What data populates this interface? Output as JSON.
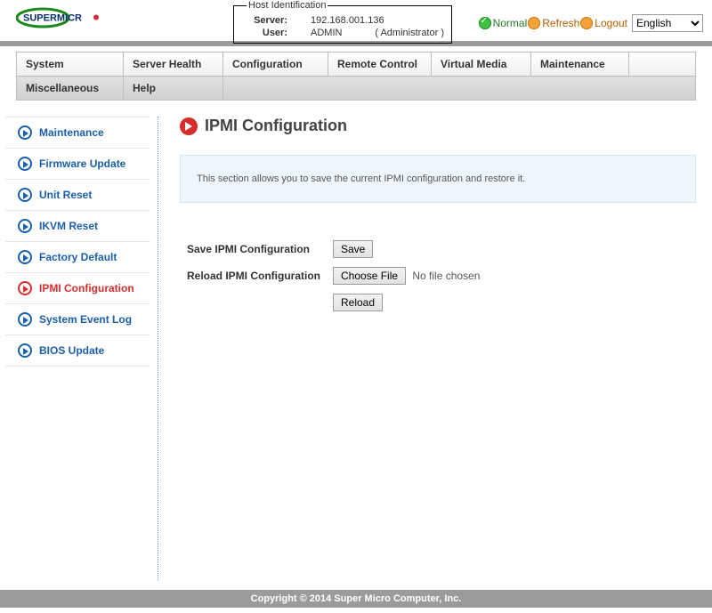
{
  "host": {
    "legend": "Host Identification",
    "server_label": "Server:",
    "server_value": "192.168.001.136",
    "user_label": "User:",
    "user_value": "ADMIN",
    "user_role": "( Administrator )"
  },
  "toplinks": {
    "normal": "Normal",
    "refresh": "Refresh",
    "logout": "Logout",
    "language": "English"
  },
  "nav": {
    "row1": [
      "System",
      "Server Health",
      "Configuration",
      "Remote Control",
      "Virtual Media",
      "Maintenance",
      ""
    ],
    "row2": [
      "Miscellaneous",
      "Help",
      "",
      "",
      "",
      "",
      ""
    ]
  },
  "sidebar": [
    {
      "label": "Maintenance",
      "active": false
    },
    {
      "label": "Firmware Update",
      "active": false
    },
    {
      "label": "Unit Reset",
      "active": false
    },
    {
      "label": "IKVM Reset",
      "active": false
    },
    {
      "label": "Factory Default",
      "active": false
    },
    {
      "label": "IPMI Configuration",
      "active": true
    },
    {
      "label": "System Event Log",
      "active": false
    },
    {
      "label": "BIOS Update",
      "active": false
    }
  ],
  "page": {
    "title": "IPMI Configuration",
    "info": "This section allows you to save the current IPMI configuration and restore it.",
    "save_label": "Save IPMI Configuration",
    "save_button": "Save",
    "reload_label": "Reload IPMI Configuration",
    "choose_button": "Choose File",
    "no_file": "No file chosen",
    "reload_button": "Reload"
  },
  "footer": "Copyright © 2014 Super Micro Computer, Inc."
}
